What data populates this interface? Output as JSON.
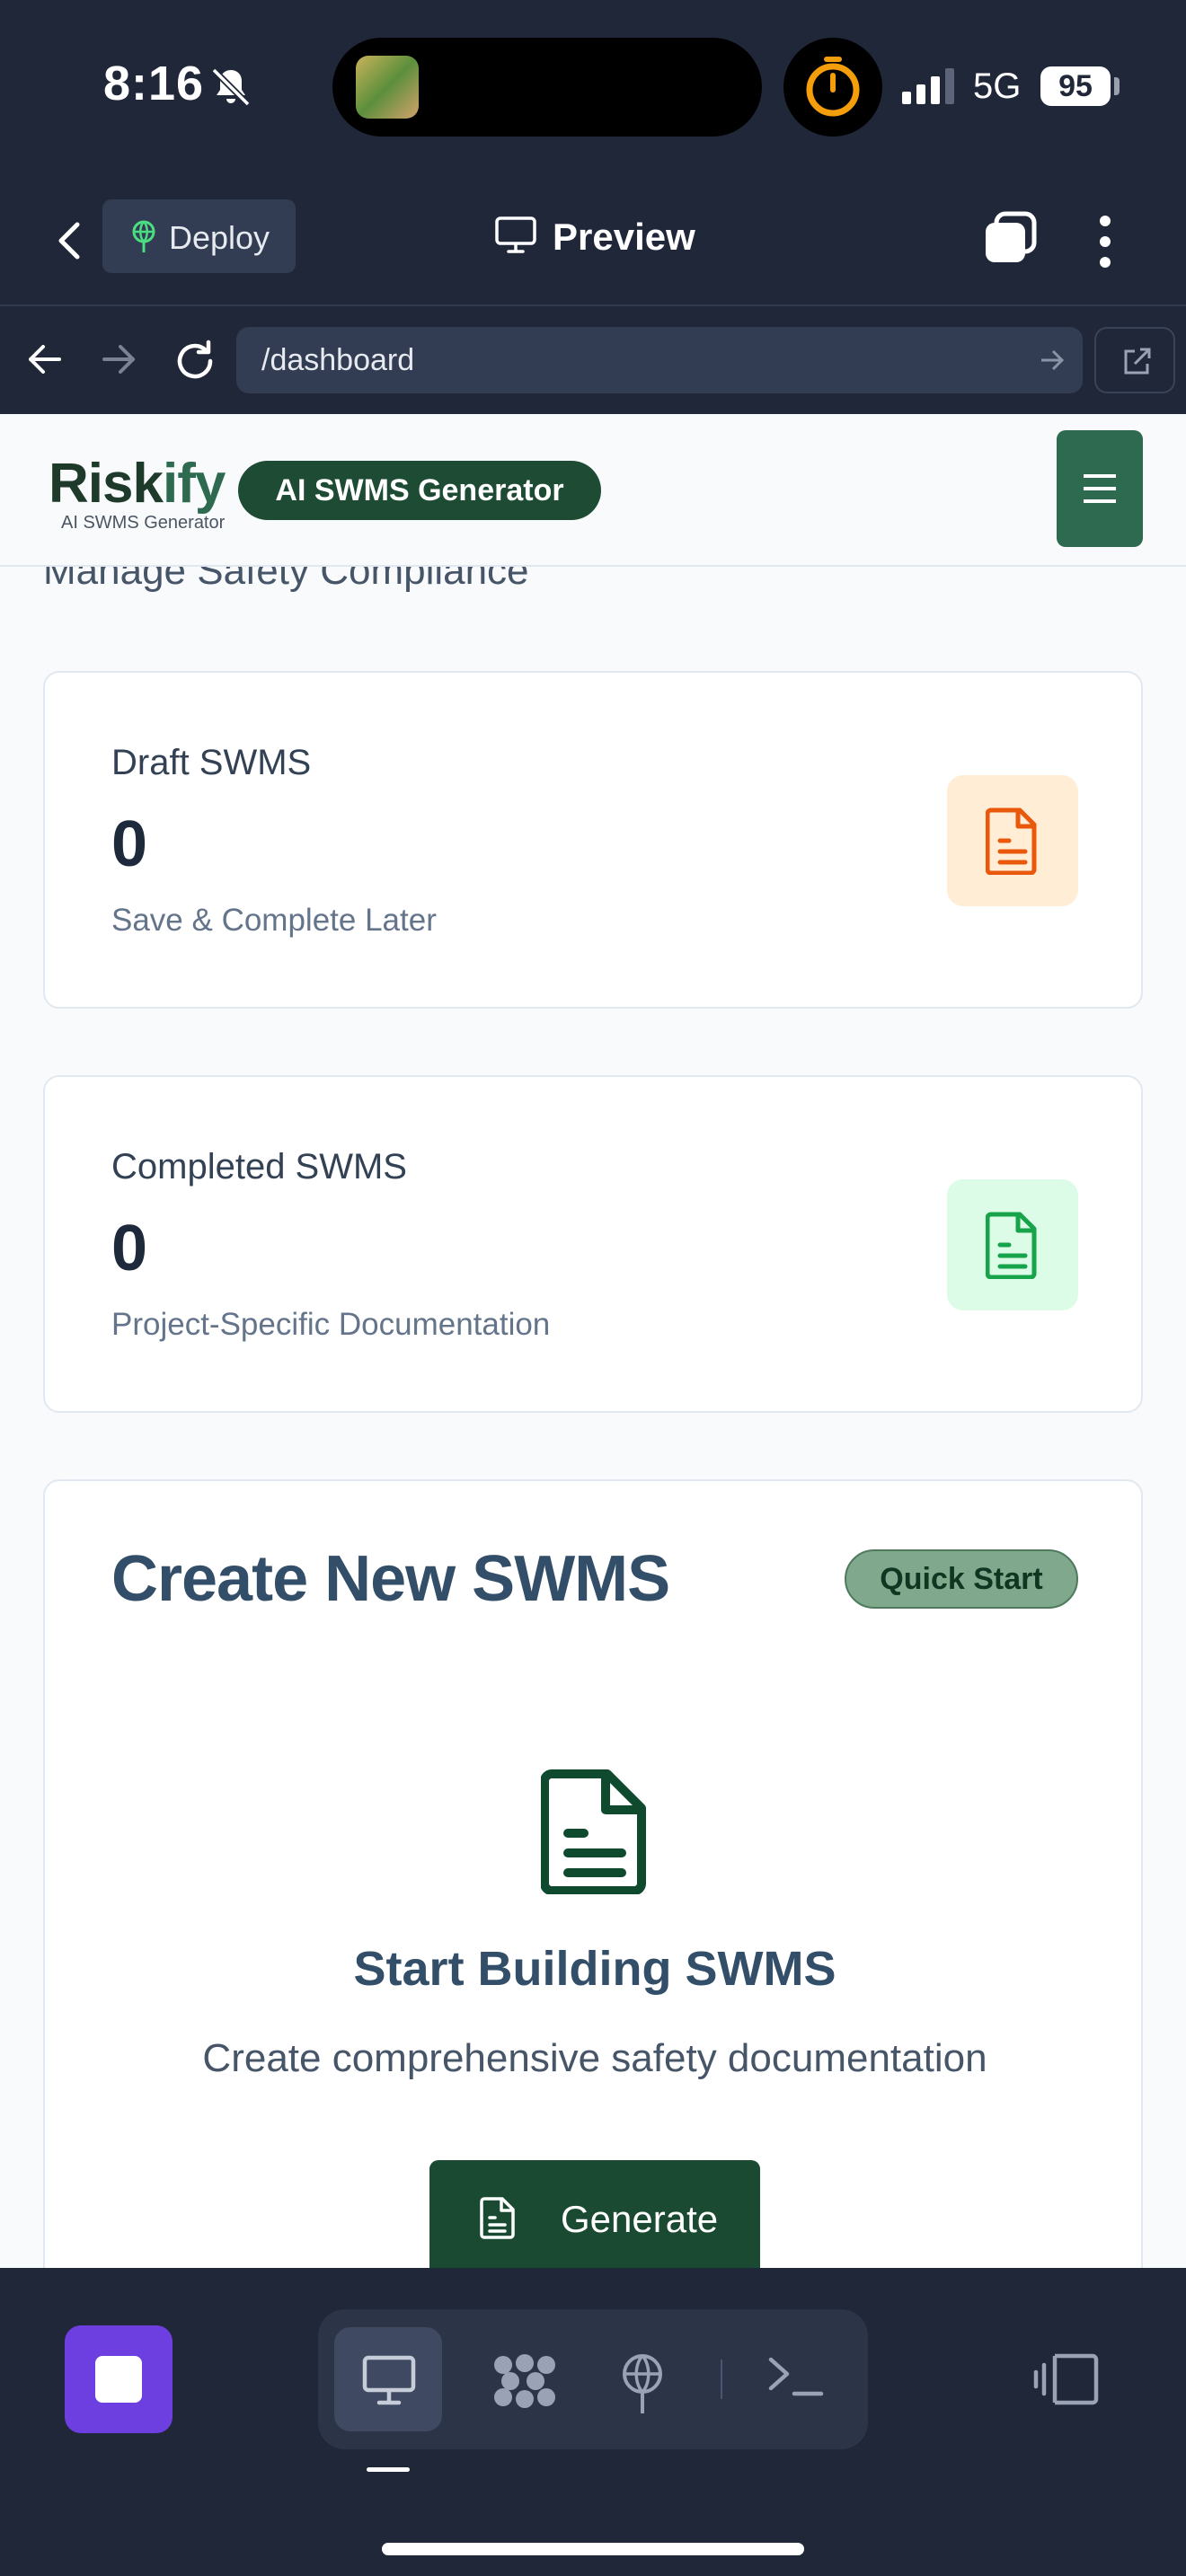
{
  "status_bar": {
    "time": "8:16",
    "network": "5G",
    "battery": "95"
  },
  "app_bar": {
    "deploy_label": "Deploy",
    "preview_label": "Preview"
  },
  "url_bar": {
    "url": "/dashboard"
  },
  "site": {
    "logo_text_a": "Risk",
    "logo_text_b": "ify",
    "logo_sub": "AI SWMS Generator",
    "badge": "AI SWMS Generator",
    "subtitle": "Manage Safety Compliance"
  },
  "cards": [
    {
      "label": "Draft SWMS",
      "count": "0",
      "desc": "Save & Complete Later",
      "icon": "document-icon",
      "icon_color": "#ea580c",
      "icon_bg": "#ffedd5"
    },
    {
      "label": "Completed SWMS",
      "count": "0",
      "desc": "Project-Specific Documentation",
      "icon": "document-icon",
      "icon_color": "#16a34a",
      "icon_bg": "#dcfce7"
    }
  ],
  "create": {
    "title": "Create New SWMS",
    "badge": "Quick Start",
    "start_title": "Start Building SWMS",
    "start_desc": "Create comprehensive safety documentation",
    "button": "Generate"
  },
  "dock": {
    "items": [
      "desktop-icon",
      "apps-icon",
      "deploy-icon",
      "terminal-icon"
    ],
    "active_index": 0
  },
  "colors": {
    "chrome_bg": "#1f2739",
    "brand_green": "#1e4b33",
    "accent_purple": "#6d3ee0"
  }
}
